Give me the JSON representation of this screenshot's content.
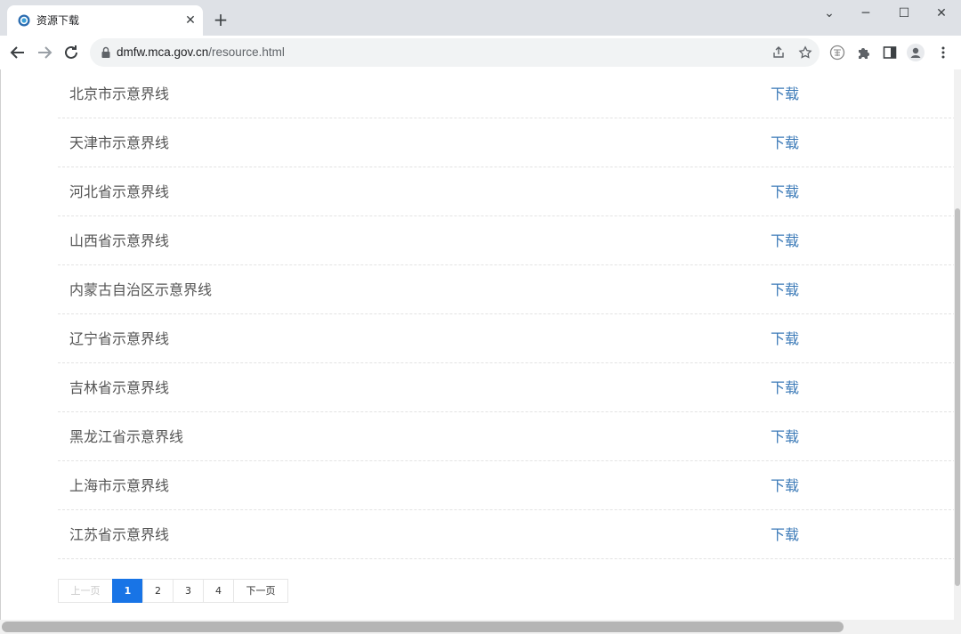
{
  "browser": {
    "tab_title": "资源下载",
    "close_tab_glyph": "✕",
    "new_tab_glyph": "+",
    "window_controls": {
      "chevron": "⌄",
      "minimize": "─",
      "maximize": "☐",
      "close": "✕"
    },
    "url_host": "dmfw.mca.gov.cn",
    "url_path": "/resource.html",
    "icons": [
      "back-icon",
      "forward-icon",
      "reload-icon",
      "lock-icon",
      "share-icon",
      "star-icon",
      "extension-badge-icon",
      "puzzle-icon",
      "side-panel-icon",
      "profile-icon",
      "kebab-menu-icon"
    ]
  },
  "resource_list": {
    "rows": [
      {
        "name": "北京市示意界线",
        "action": "下载"
      },
      {
        "name": "天津市示意界线",
        "action": "下载"
      },
      {
        "name": "河北省示意界线",
        "action": "下载"
      },
      {
        "name": "山西省示意界线",
        "action": "下载"
      },
      {
        "name": "内蒙古自治区示意界线",
        "action": "下载"
      },
      {
        "name": "辽宁省示意界线",
        "action": "下载"
      },
      {
        "name": "吉林省示意界线",
        "action": "下载"
      },
      {
        "name": "黑龙江省示意界线",
        "action": "下载"
      },
      {
        "name": "上海市示意界线",
        "action": "下载"
      },
      {
        "name": "江苏省示意界线",
        "action": "下载"
      }
    ]
  },
  "pagination": {
    "prev": "上一页",
    "pages": [
      "1",
      "2",
      "3",
      "4"
    ],
    "current": "1",
    "next": "下一页"
  },
  "colors": {
    "link": "#3d7bb8",
    "active_page": "#1874e6",
    "text": "#555555"
  }
}
